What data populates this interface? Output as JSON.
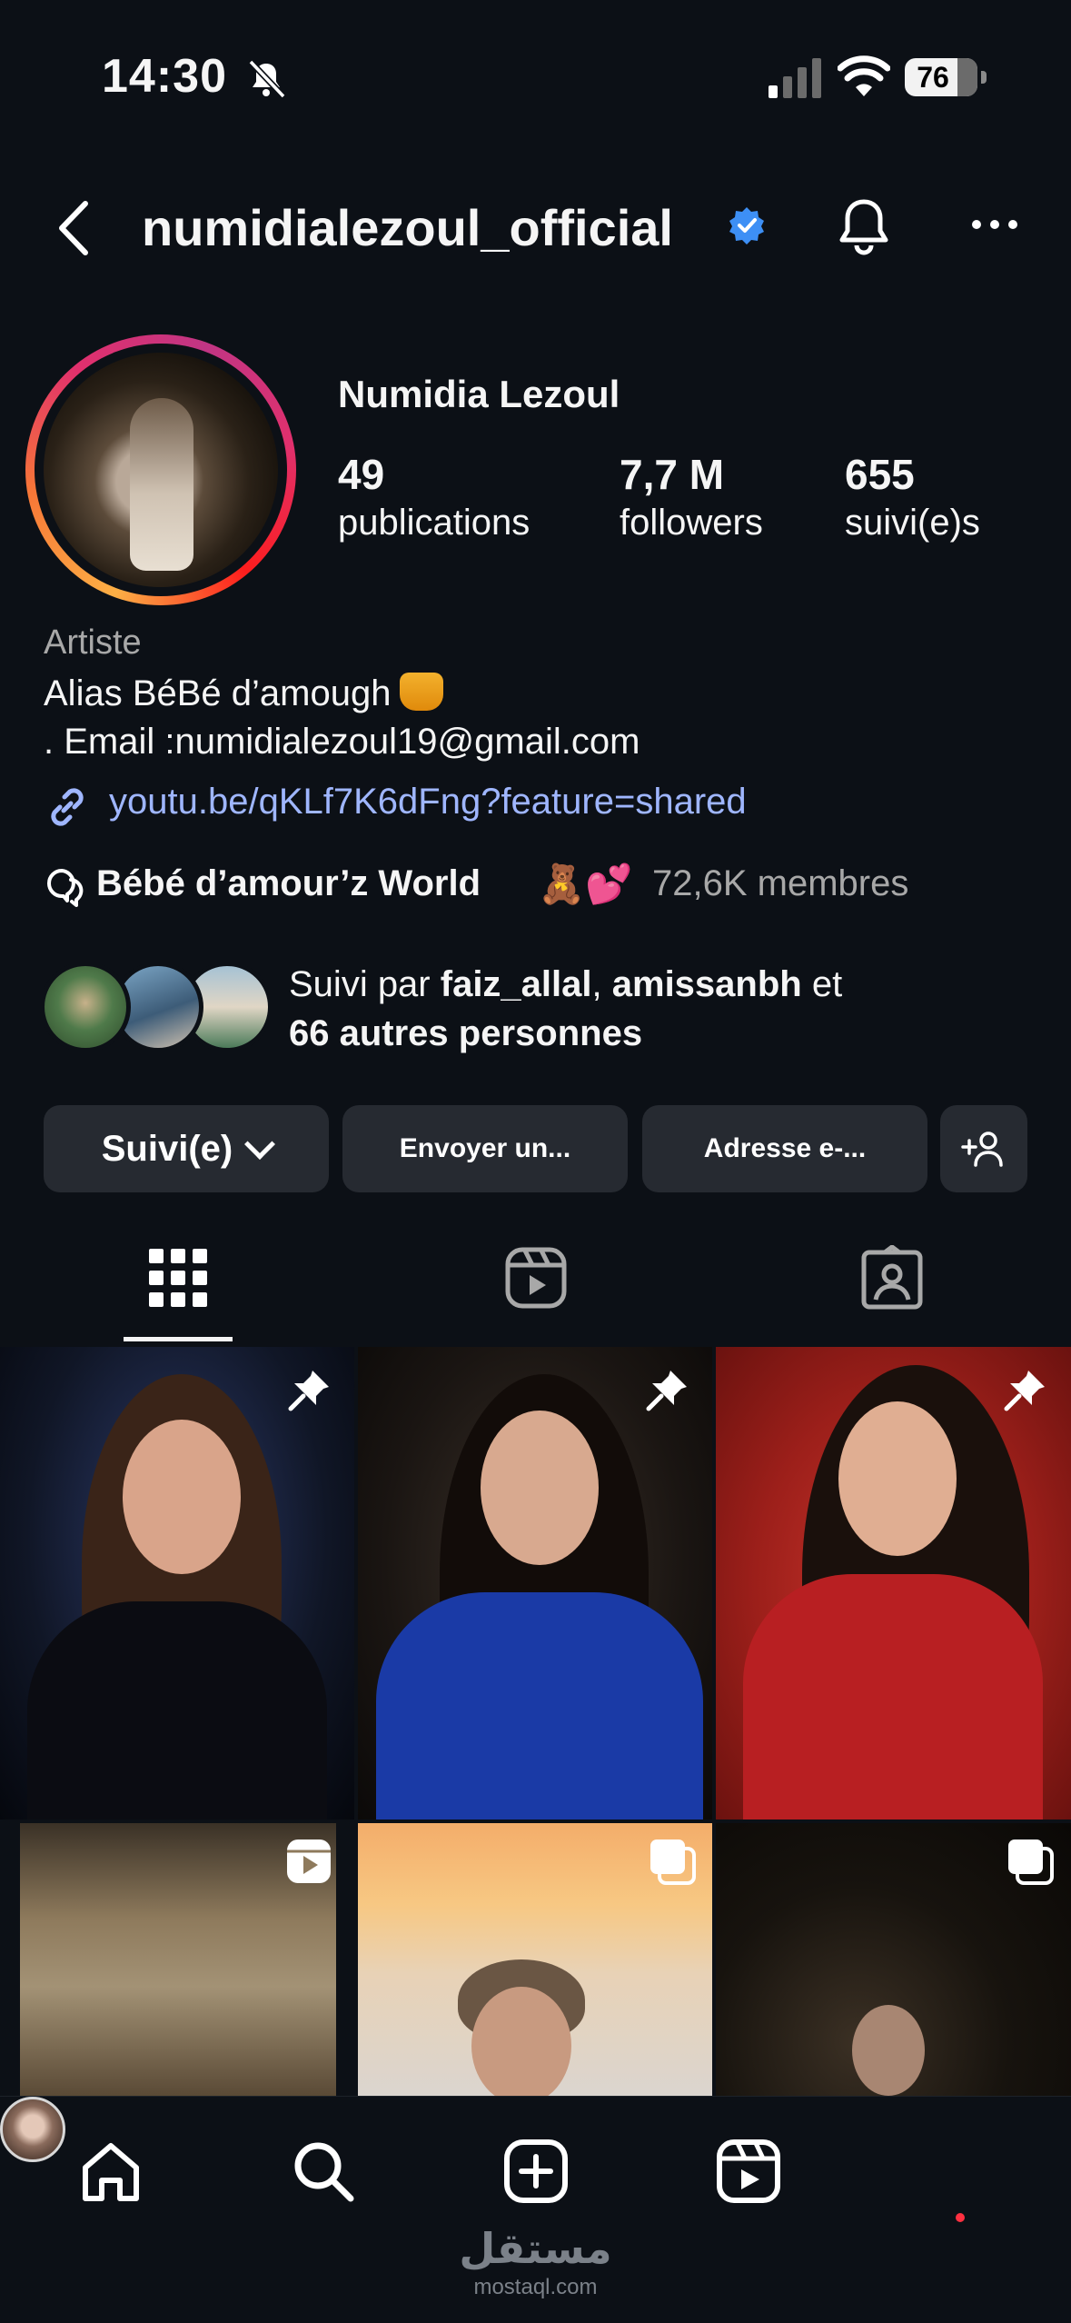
{
  "status_bar": {
    "time": "14:30",
    "battery": "76"
  },
  "header": {
    "username": "numidialezoul_official"
  },
  "profile": {
    "display_name": "Numidia Lezoul",
    "stats": [
      {
        "value": "49",
        "label": "publications"
      },
      {
        "value": "7,7 M",
        "label": "followers"
      },
      {
        "value": "655",
        "label": "suivi(e)s"
      }
    ]
  },
  "bio": {
    "category": "Artiste",
    "line1": "Alias BéBé d’amough",
    "line2": ". Email :numidialezoul19@gmail.com",
    "link": "youtu.be/qKLf7K6dFng?feature=shared"
  },
  "channel": {
    "name": "Bébé d’amour’z World",
    "emoji": "🧸💕",
    "members": "72,6K membres"
  },
  "followed_by": {
    "prefix": "Suivi par ",
    "user1": "faiz_allal",
    "sep": ", ",
    "user2": "amissanbh",
    "suffix": " et",
    "others": "66 autres personnes"
  },
  "buttons": {
    "following": "Suivi(e)",
    "message": "Envoyer un...",
    "email": "Adresse e-..."
  },
  "tabs": [
    "grid",
    "reels",
    "tagged"
  ],
  "watermark": {
    "arabic": "مستقل",
    "latin": "mostaql.com"
  },
  "colors": {
    "background": "#0c1016",
    "link": "#9fb6ff",
    "verified": "#3d8ff5",
    "button": "#262a31",
    "notification_dot": "#ff3040"
  }
}
